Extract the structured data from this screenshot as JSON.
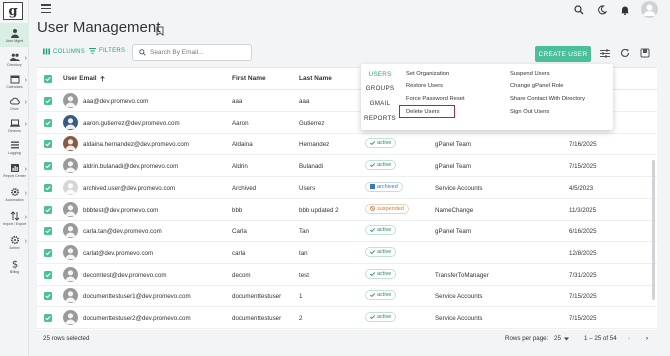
{
  "logo": {
    "letter": "g"
  },
  "sidebar": {
    "items": [
      {
        "label": "User Mgmt",
        "icon": "person-icon",
        "active": true
      },
      {
        "label": "Directory",
        "icon": "people-icon"
      },
      {
        "label": "Calendars",
        "icon": "calendar-icon"
      },
      {
        "label": "Drive",
        "icon": "cloud-icon"
      },
      {
        "label": "Devices",
        "icon": "laptop-icon"
      },
      {
        "label": "Logging",
        "icon": "list-icon"
      },
      {
        "label": "Report Center",
        "icon": "report-icon"
      },
      {
        "label": "Automation",
        "icon": "gear-icon"
      },
      {
        "label": "Import / Export",
        "icon": "import-export-icon"
      },
      {
        "label": "Admin",
        "icon": "settings-icon"
      },
      {
        "label": "Billing",
        "icon": "dollar-icon"
      }
    ]
  },
  "header": {
    "title": "User Management"
  },
  "toolbar": {
    "columns_label": "COLUMNS",
    "filters_label": "FILTERS",
    "search_placeholder": "Search By Email...",
    "create_label": "CREATE USER"
  },
  "table": {
    "headers": {
      "email": "User Email",
      "first": "First Name",
      "last": "Last Name"
    },
    "rows": [
      {
        "email": "aaa@dev.promevo.com",
        "first": "aaa",
        "last": "aaa",
        "status": "",
        "group": "",
        "date": "",
        "avatar": "generic"
      },
      {
        "email": "aaron.gutierrez@dev.promevo.com",
        "first": "Aaron",
        "last": "Gutierrez",
        "status": "",
        "group": "",
        "date": "",
        "avatar": "photo"
      },
      {
        "email": "aldaina.hernandez@dev.promevo.com",
        "first": "Aldaina",
        "last": "Hernandez",
        "status": "active",
        "group": "gPanel Team",
        "date": "7/16/2025",
        "avatar": "photo2"
      },
      {
        "email": "aldrin.bulanadi@dev.promevo.com",
        "first": "Aldrin",
        "last": "Bulanadi",
        "status": "active",
        "group": "gPanel Team",
        "date": "7/15/2025",
        "avatar": "generic"
      },
      {
        "email": "archived.user@dev.promevo.com",
        "first": "Archived",
        "last": "Users",
        "status": "archived",
        "group": "Service Accounts",
        "date": "4/5/2023",
        "avatar": "light"
      },
      {
        "email": "bbbtest@dev.promevo.com",
        "first": "bbb",
        "last": "bbb updated 2",
        "status": "suspended",
        "group": "NameChange",
        "date": "11/3/2025",
        "avatar": "generic"
      },
      {
        "email": "carla.tan@dev.promevo.com",
        "first": "Carla",
        "last": "Tan",
        "status": "active",
        "group": "gPanel Team",
        "date": "6/16/2025",
        "avatar": "generic"
      },
      {
        "email": "carlat@dev.promevo.com",
        "first": "carla",
        "last": "tan",
        "status": "active",
        "group": "",
        "date": "12/8/2025",
        "avatar": "generic"
      },
      {
        "email": "decomtest@dev.promevo.com",
        "first": "decom",
        "last": "test",
        "status": "active",
        "group": "TransferToManager",
        "date": "7/31/2025",
        "avatar": "generic"
      },
      {
        "email": "documenttestuser1@dev.promevo.com",
        "first": "documenttestuser",
        "last": "1",
        "status": "active",
        "group": "Service Accounts",
        "date": "7/15/2025",
        "avatar": "generic"
      },
      {
        "email": "documenttestuser2@dev.promevo.com",
        "first": "documenttestuser",
        "last": "2",
        "status": "active",
        "group": "Service Accounts",
        "date": "7/15/2025",
        "avatar": "generic"
      }
    ]
  },
  "dropdown": {
    "tabs": [
      "USERS",
      "GROUPS",
      "GMAIL",
      "REPORTS"
    ],
    "col1": [
      "Set Organization",
      "Restore Users",
      "Force Password Reset",
      "Delete Users"
    ],
    "col2": [
      "Suspend Users",
      "Change gPanel Role",
      "Share Contact With Directory",
      "Sign Out Users"
    ]
  },
  "footer": {
    "selected": "25 rows selected",
    "rows_per_page_label": "Rows per page:",
    "rows_per_page": "25",
    "range": "1 – 25 of 54"
  },
  "colors": {
    "accent": "#4cbf9a",
    "active": "#2a8a62",
    "archived": "#3a78c2",
    "suspended": "#d07a35",
    "highlight": "#b3262e"
  }
}
